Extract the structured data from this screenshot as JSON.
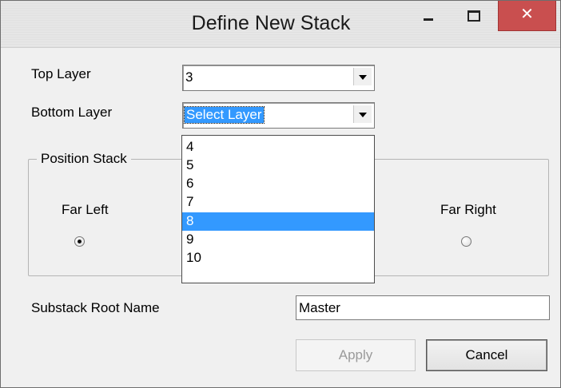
{
  "window": {
    "title": "Define New Stack",
    "close_glyph": "✕",
    "icons": {
      "minimize": "minimize-icon",
      "maximize": "maximize-icon",
      "close": "close-icon"
    }
  },
  "top_layer": {
    "label": "Top Layer",
    "value": "3"
  },
  "bottom_layer": {
    "label": "Bottom Layer",
    "value": "Select Layer",
    "options": [
      "4",
      "5",
      "6",
      "7",
      "8",
      "9",
      "10"
    ],
    "highlighted": "8"
  },
  "position_stack": {
    "legend": "Position Stack",
    "far_left": {
      "label": "Far Left",
      "checked": true
    },
    "far_right": {
      "label": "Far Right",
      "checked": false
    }
  },
  "substack": {
    "label": "Substack Root Name",
    "value": "Master"
  },
  "buttons": {
    "apply": "Apply",
    "cancel": "Cancel"
  },
  "colors": {
    "selection": "#3399ff",
    "close_button": "#c94f4f"
  }
}
